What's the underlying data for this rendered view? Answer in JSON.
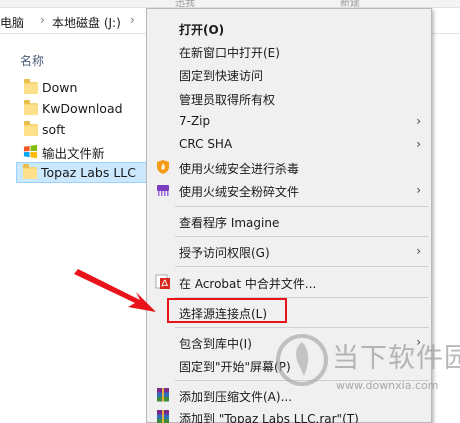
{
  "explorer": {
    "top_labels": [
      "迅我",
      "新建"
    ],
    "breadcrumb": [
      "电脑",
      "本地磁盘 (J:)"
    ],
    "column_header": "名称",
    "files": [
      {
        "name": "Down",
        "icon": "folder-icon",
        "selected": false
      },
      {
        "name": "KwDownload",
        "icon": "folder-icon",
        "selected": false
      },
      {
        "name": "soft",
        "icon": "folder-icon",
        "selected": false
      },
      {
        "name": "输出文件新",
        "icon": "windows-logo-icon",
        "selected": false
      },
      {
        "name": "Topaz Labs LLC",
        "icon": "folder-icon",
        "selected": true
      }
    ]
  },
  "context_menu": {
    "items": [
      {
        "label": "打开(O)",
        "bold": true
      },
      {
        "label": "在新窗口中打开(E)"
      },
      {
        "label": "固定到快速访问"
      },
      {
        "label": "管理员取得所有权"
      },
      {
        "label": "7-Zip",
        "submenu": true
      },
      {
        "label": "CRC SHA",
        "submenu": true
      },
      {
        "label": "使用火绒安全进行杀毒",
        "icon": "huorong-shield-icon"
      },
      {
        "label": "使用火绒安全粉碎文件",
        "icon": "shredder-icon",
        "submenu": true
      },
      {
        "label": "查看程序 Imagine"
      },
      {
        "label": "授予访问权限(G)",
        "submenu": true
      },
      {
        "label": "在 Acrobat 中合并文件...",
        "icon": "acrobat-icon"
      },
      {
        "label": "选择源连接点(L)",
        "highlighted": true
      },
      {
        "label": "包含到库中(I)",
        "submenu": true
      },
      {
        "label": "固定到\"开始\"屏幕(P)"
      },
      {
        "label": "添加到压缩文件(A)...",
        "icon": "winrar-icon"
      },
      {
        "label": "添加到 \"Topaz Labs LLC.rar\"(T)",
        "icon": "winrar-icon"
      }
    ],
    "arrow_glyph": "›"
  },
  "annotation": {
    "color": "#e8141a"
  },
  "watermark": {
    "title": "当下软件园",
    "url": "www.downxia.com"
  }
}
